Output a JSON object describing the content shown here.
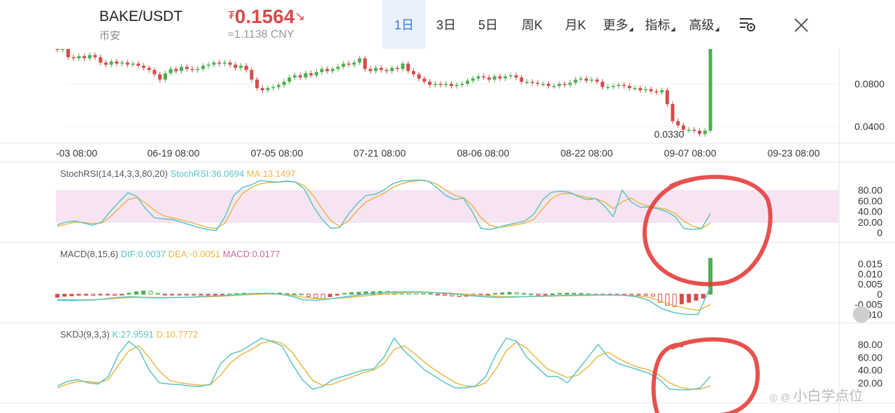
{
  "header": {
    "pair": "BAKE/USDT",
    "exchange": "币安",
    "price_currency": "₮",
    "price": "0.1564",
    "price_arrow": "↘",
    "cny": "≈1.1138 CNY"
  },
  "tabs": [
    {
      "label": "1日",
      "active": true
    },
    {
      "label": "3日"
    },
    {
      "label": "5日"
    },
    {
      "label": "周K"
    },
    {
      "label": "月K"
    },
    {
      "label": "更多",
      "dropdown": true
    },
    {
      "label": "指标",
      "dropdown": true
    },
    {
      "label": "高级",
      "dropdown": true
    }
  ],
  "icons": {
    "settings": "chart-settings-icon",
    "close": "close-icon"
  },
  "colors": {
    "up": "#4caf50",
    "down": "#d84a4a",
    "cyan": "#5cc4c4",
    "yellow": "#e8b84a",
    "pink": "#c86aa0",
    "band": "#f7e4f3",
    "annotation": "#e53935",
    "active_tab": "#3b78d8"
  },
  "watermark": "小白学点位",
  "chart_data": [
    {
      "type": "candlestick",
      "y_ticks": [
        "0.0800",
        "0.0400"
      ],
      "y_tick_values": [
        0.08,
        0.04
      ],
      "x_ticks": [
        "-03 08:00",
        "06-19 08:00",
        "07-05 08:00",
        "07-21 08:00",
        "08-06 08:00",
        "08-22 08:00",
        "09-07 08:00",
        "09-23 08:00"
      ],
      "low_label": "0.0330",
      "close": [
        0.112,
        0.113,
        0.105,
        0.104,
        0.106,
        0.104,
        0.107,
        0.105,
        0.1,
        0.098,
        0.101,
        0.099,
        0.1,
        0.098,
        0.099,
        0.097,
        0.095,
        0.093,
        0.089,
        0.084,
        0.09,
        0.094,
        0.092,
        0.096,
        0.094,
        0.093,
        0.094,
        0.097,
        0.098,
        0.1,
        0.099,
        0.1,
        0.098,
        0.095,
        0.097,
        0.093,
        0.084,
        0.076,
        0.074,
        0.076,
        0.077,
        0.079,
        0.082,
        0.086,
        0.088,
        0.086,
        0.09,
        0.088,
        0.091,
        0.094,
        0.092,
        0.094,
        0.096,
        0.099,
        0.098,
        0.1,
        0.104,
        0.094,
        0.092,
        0.095,
        0.093,
        0.092,
        0.095,
        0.094,
        0.099,
        0.092,
        0.089,
        0.085,
        0.082,
        0.079,
        0.08,
        0.079,
        0.08,
        0.078,
        0.079,
        0.08,
        0.083,
        0.085,
        0.087,
        0.086,
        0.084,
        0.087,
        0.085,
        0.087,
        0.088,
        0.086,
        0.082,
        0.082,
        0.081,
        0.08,
        0.08,
        0.078,
        0.078,
        0.08,
        0.079,
        0.081,
        0.084,
        0.085,
        0.083,
        0.084,
        0.082,
        0.077,
        0.077,
        0.078,
        0.079,
        0.078,
        0.076,
        0.076,
        0.074,
        0.075,
        0.073,
        0.072,
        0.074,
        0.061,
        0.045,
        0.041,
        0.037,
        0.037,
        0.036,
        0.033,
        0.036,
        0.125
      ]
    },
    {
      "type": "line",
      "label": "StochRSI(14,14,3,3,80,20)",
      "series": [
        {
          "name": "StochRSI",
          "value": "36.0694"
        },
        {
          "name": "MA",
          "value": "13.1497"
        }
      ],
      "y_ticks": [
        "80.00",
        "60.00",
        "40.00",
        "20.00",
        "0"
      ],
      "y_tick_values": [
        80,
        60,
        40,
        20,
        0
      ],
      "band": [
        20,
        80
      ],
      "k": [
        15,
        20,
        22,
        18,
        14,
        20,
        40,
        58,
        75,
        68,
        45,
        28,
        26,
        25,
        20,
        15,
        10,
        6,
        4,
        30,
        70,
        85,
        90,
        98,
        96,
        95,
        97,
        95,
        82,
        50,
        25,
        8,
        10,
        35,
        55,
        70,
        72,
        80,
        92,
        97,
        98,
        99,
        97,
        85,
        70,
        62,
        65,
        40,
        8,
        6,
        10,
        15,
        18,
        22,
        35,
        62,
        76,
        78,
        76,
        68,
        62,
        64,
        50,
        30,
        80,
        58,
        48,
        48,
        45,
        40,
        30,
        8,
        6,
        8,
        36
      ],
      "d": [
        12,
        16,
        20,
        19,
        17,
        18,
        30,
        46,
        62,
        66,
        56,
        42,
        32,
        28,
        24,
        20,
        15,
        10,
        8,
        18,
        50,
        74,
        85,
        92,
        94,
        95,
        96,
        95,
        88,
        70,
        45,
        22,
        12,
        22,
        42,
        58,
        66,
        74,
        85,
        92,
        96,
        98,
        97,
        91,
        80,
        70,
        66,
        52,
        28,
        14,
        10,
        12,
        15,
        18,
        25,
        45,
        64,
        73,
        74,
        70,
        66,
        64,
        58,
        45,
        58,
        65,
        55,
        50,
        47,
        44,
        36,
        22,
        12,
        8,
        18
      ]
    },
    {
      "type": "bar+line",
      "label": "MACD(8,15,6)",
      "series": [
        {
          "name": "DIF",
          "value": "0.0037"
        },
        {
          "name": "DEA",
          "value": "-0.0051"
        },
        {
          "name": "MACD",
          "value": "0.0177"
        }
      ],
      "y_ticks": [
        "0.015",
        "0.010",
        "0.005",
        "0",
        "-0.005",
        "-0.010"
      ],
      "y_tick_values": [
        0.015,
        0.01,
        0.005,
        0,
        -0.005,
        -0.01
      ],
      "hist": [
        -0.0015,
        -0.001,
        -0.0008,
        -0.0005,
        -0.0005,
        -0.0006,
        -0.0004,
        -0.0004,
        -0.0006,
        -0.0002,
        0.0005,
        0.0012,
        0.0016,
        0.0015,
        0.0004,
        -0.0002,
        -0.0002,
        -0.0003,
        -0.0003,
        -0.0004,
        -0.0003,
        -0.0002,
        -0.0002,
        -0.0001,
        0.0001,
        0.0003,
        0.0005,
        0.0004,
        0.0005,
        0.0006,
        0.0005,
        0.0006,
        0.0004,
        0.0002,
        0.0001,
        -0.0012,
        -0.0018,
        -0.0022,
        -0.0012,
        -0.0005,
        0.0004,
        0.0008,
        0.001,
        0.0012,
        0.0013,
        0.0014,
        0.0014,
        0.0013,
        0.0011,
        0.001,
        0.0009,
        0.0007,
        0.0004,
        -0.0002,
        -0.0006,
        -0.0009,
        -0.0012,
        -0.001,
        -0.0008,
        -0.0004,
        -0.0002,
        0.0004,
        0.0007,
        0.0009,
        0.0008,
        0.0004,
        0.0001,
        -0.0002,
        -0.0001,
        0.0002,
        0.0004,
        0.0005,
        0.0005,
        0.0004,
        0.0002,
        -0.0001,
        -0.0003,
        -0.0005,
        -0.0004,
        -0.0002,
        -0.0003,
        -0.0004,
        -0.0006,
        -0.001,
        -0.004,
        -0.0055,
        -0.006,
        -0.0048,
        -0.004,
        -0.003,
        -0.002,
        0.0177
      ],
      "dif": [
        -0.003,
        -0.0032,
        -0.003,
        -0.0028,
        -0.0022,
        -0.0015,
        -0.0012,
        -0.0016,
        -0.0018,
        -0.0017,
        -0.0016,
        -0.0014,
        -0.001,
        -0.0008,
        -0.0005,
        0.0,
        0.0003,
        0.0004,
        0.0001,
        -0.001,
        -0.0028,
        -0.003,
        -0.0024,
        -0.0016,
        -0.0008,
        0.0,
        0.0006,
        0.001,
        0.0012,
        0.0012,
        0.001,
        0.0006,
        0.0002,
        -0.0004,
        -0.001,
        -0.0014,
        -0.0016,
        -0.0014,
        -0.0012,
        -0.001,
        -0.0008,
        -0.0006,
        -0.0005,
        -0.0004,
        -0.0003,
        -0.0004,
        -0.0006,
        -0.0012,
        -0.003,
        -0.007,
        -0.009,
        -0.01,
        -0.01,
        0.0037
      ],
      "dea": [
        -0.0025,
        -0.0027,
        -0.0028,
        -0.0027,
        -0.0024,
        -0.002,
        -0.0016,
        -0.0015,
        -0.0016,
        -0.0016,
        -0.0016,
        -0.0015,
        -0.0013,
        -0.0011,
        -0.0008,
        -0.0004,
        -0.0001,
        0.0001,
        0.0,
        -0.0005,
        -0.0015,
        -0.0022,
        -0.0022,
        -0.0019,
        -0.0014,
        -0.0008,
        -0.0002,
        0.0003,
        0.0007,
        0.0009,
        0.0009,
        0.0008,
        0.0005,
        0.0001,
        -0.0004,
        -0.0008,
        -0.0011,
        -0.0012,
        -0.0012,
        -0.0011,
        -0.001,
        -0.0008,
        -0.0007,
        -0.0006,
        -0.0005,
        -0.0005,
        -0.0005,
        -0.0008,
        -0.0015,
        -0.0035,
        -0.0055,
        -0.007,
        -0.008,
        -0.0051
      ]
    },
    {
      "type": "line",
      "label": "SKDJ(9,3,3)",
      "series": [
        {
          "name": "K",
          "value": "27.9591"
        },
        {
          "name": "D",
          "value": "10.7772"
        }
      ],
      "y_ticks": [
        "80.00",
        "60.00",
        "40.00",
        "20.00"
      ],
      "y_tick_values": [
        80,
        60,
        40,
        20
      ],
      "k": [
        15,
        22,
        25,
        20,
        18,
        30,
        65,
        85,
        72,
        40,
        20,
        18,
        17,
        15,
        14,
        18,
        50,
        65,
        70,
        80,
        90,
        85,
        78,
        50,
        25,
        10,
        14,
        25,
        30,
        35,
        40,
        42,
        60,
        90,
        70,
        55,
        40,
        30,
        20,
        12,
        12,
        15,
        30,
        65,
        90,
        85,
        60,
        45,
        30,
        30,
        20,
        40,
        60,
        80,
        60,
        50,
        45,
        40,
        35,
        25,
        10,
        9,
        9,
        12,
        30
      ],
      "d": [
        12,
        18,
        22,
        22,
        20,
        25,
        48,
        70,
        78,
        60,
        38,
        24,
        20,
        18,
        16,
        17,
        32,
        52,
        64,
        72,
        82,
        86,
        82,
        68,
        46,
        24,
        16,
        18,
        24,
        30,
        36,
        40,
        50,
        72,
        78,
        66,
        52,
        40,
        30,
        20,
        15,
        14,
        20,
        42,
        70,
        84,
        74,
        58,
        42,
        35,
        28,
        32,
        45,
        62,
        68,
        58,
        50,
        44,
        40,
        32,
        20,
        13,
        10,
        10,
        15
      ]
    }
  ]
}
